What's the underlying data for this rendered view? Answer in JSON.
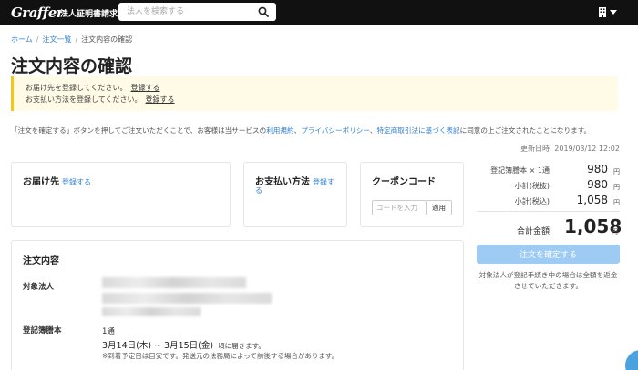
{
  "header": {
    "logo": "Graffer",
    "logo_sub": "法人証明書請求",
    "search_placeholder": "法人を検索する"
  },
  "breadcrumb": {
    "home": "ホーム",
    "orders": "注文一覧",
    "current": "注文内容の確認",
    "sep": "/"
  },
  "page_title": "注文内容の確認",
  "warning": {
    "line1_text": "お届け先を登録してください。",
    "line1_link": "登録する",
    "line2_text": "お支払い方法を登録してください。",
    "line2_link": "登録する"
  },
  "agreement": {
    "pre": "「注文を確定する」ボタンを押してご注文いただくことで、お客様は当サービスの",
    "link1": "利用規約",
    "comma1": "、",
    "link2": "プライバシーポリシー",
    "comma2": "、",
    "link3": "特定商取引法に基づく表記",
    "post": "に同意の上ご注文されたことになります。"
  },
  "delivery_card": {
    "title": "お届け先",
    "link": "登録する"
  },
  "payment_card": {
    "title": "お支払い方法",
    "link_a": "登録す",
    "link_b": "る"
  },
  "coupon_card": {
    "title": "クーポンコード",
    "placeholder": "コードを入力",
    "apply": "適用"
  },
  "order_card": {
    "title": "注文内容",
    "corp_label": "対象法人",
    "doc_label": "登記簿謄本",
    "qty": "1通",
    "date_range": "3月14日(木) ~ 3月15日(金)",
    "date_suffix": "頃に届きます。",
    "date_note": "※到着予定日は目安です。発送元の法務局によって前後する場合があります。"
  },
  "summary": {
    "updated": "更新日時: 2019/03/12 12:02",
    "rows": [
      {
        "label": "登記簿謄本 × 1通",
        "value": "980",
        "unit": "円"
      },
      {
        "label": "小計(税抜)",
        "value": "980",
        "unit": "円"
      },
      {
        "label": "小計(税込)",
        "value": "1,058",
        "unit": "円"
      }
    ],
    "total_label": "合計金額",
    "total_value": "1,058",
    "total_unit": "円",
    "confirm_label": "注文を確定する",
    "note": "対象法人が登記手続き中の場合は全額を返金させていただきます。"
  }
}
